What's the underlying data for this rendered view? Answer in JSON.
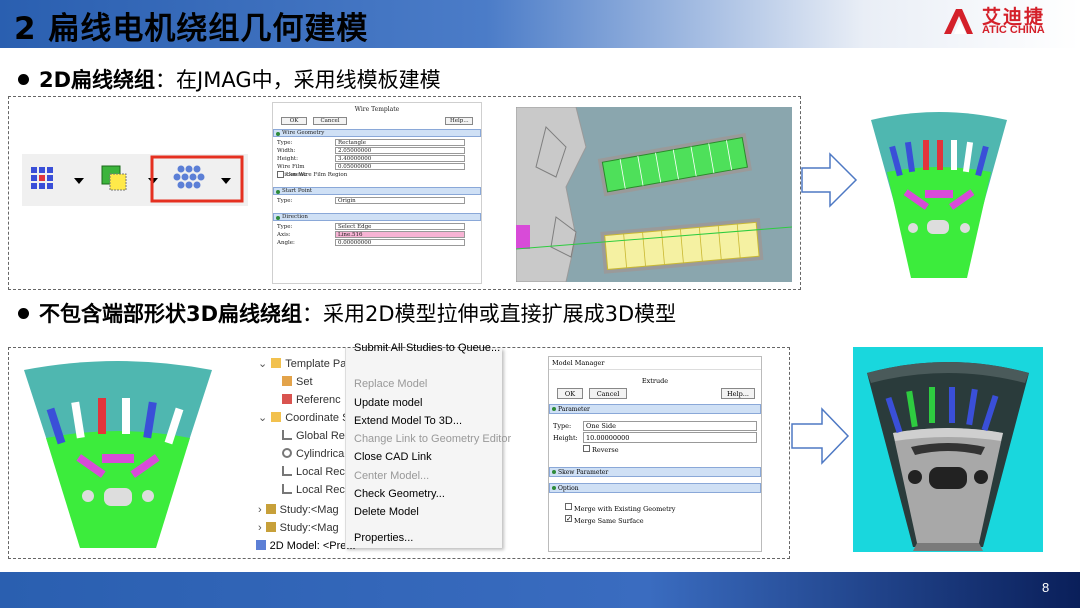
{
  "header": {
    "title": "2 扁线电机绕组几何建模",
    "logo_cn": "艾迪捷",
    "logo_en": "ATIC CHINA"
  },
  "bullets": [
    {
      "bold": "2D扁线绕组",
      "rest": "：在JMAG中，采用线模板建模"
    },
    {
      "bold": "不包含端部形状3D扁线绕组",
      "rest": "：采用2D模型拉伸或直接扩展成3D模型"
    }
  ],
  "wire_template": {
    "title": "Wire Template",
    "ok": "OK",
    "cancel": "Cancel",
    "help": "Help...",
    "sec_geometry": "Wire Geometry",
    "type_label": "Type:",
    "type_value": "Rectangle",
    "width_label": "Width:",
    "width_value": "2.05000000",
    "height_label": "Height:",
    "height_value": "3.40000000",
    "film_label": "Wire Film Thickness:",
    "film_value": "0.05000000",
    "use_region": "Use Wire Film Region",
    "sec_start": "Start Point",
    "start_type_value": "Origin",
    "sec_direction": "Direction",
    "dir_type_value": "Select Edge",
    "axis_label": "Axis:",
    "axis_value": "Line.516",
    "angle_label": "Angle:",
    "angle_value": "0.00000000"
  },
  "tree": {
    "items": [
      "Template Pa",
      "Set",
      "Referenc",
      "Coordinate S",
      "Global Re",
      "Cylindrica",
      "Local Rec",
      "Local Rec",
      "Study:<Mag",
      "Study:<Mag",
      "2D Model: <Pre..."
    ]
  },
  "context_menu": {
    "items": [
      {
        "label": "Submit All Studies to Queue...",
        "disabled": false
      },
      {
        "label": "Replace Model",
        "disabled": true
      },
      {
        "label": "Update model",
        "disabled": false
      },
      {
        "label": "Extend Model To 3D...",
        "disabled": false
      },
      {
        "label": "Change Link to Geometry Editor",
        "disabled": true
      },
      {
        "label": "Close CAD Link",
        "disabled": false
      },
      {
        "label": "Center Model...",
        "disabled": true
      },
      {
        "label": "Check Geometry...",
        "disabled": false
      },
      {
        "label": "Delete Model",
        "disabled": false
      },
      {
        "label": "Properties...",
        "disabled": false
      }
    ]
  },
  "model_manager": {
    "title": "Model Manager",
    "subtitle": "Extrude",
    "ok": "OK",
    "cancel": "Cancel",
    "help": "Help...",
    "sec_parameter": "Parameter",
    "type_label": "Type:",
    "type_value": "One Side",
    "height_label": "Height:",
    "height_value": "10.00000000",
    "reverse": "Reverse",
    "sec_skew": "Skew Parameter",
    "sec_option": "Option",
    "merge_existing": "Merge with Existing Geometry",
    "merge_same": "Merge Same Surface"
  },
  "footer": {
    "page": "8"
  },
  "colors": {
    "title_blue": "#2a5fb0",
    "logo_red": "#d4202a",
    "stator": "#4fb7b0",
    "rotor_green": "#3cec3c",
    "coil_red": "#e2343b",
    "coil_blue": "#3a4fd8",
    "magnet_pink": "#d84bd8"
  },
  "icons": [
    "grid-dots-icon",
    "dropdown-arrow-icon",
    "boolean-square-icon",
    "wire-template-icon",
    "right-arrow-icon",
    "folder-icon",
    "expand-chevron-icon"
  ]
}
